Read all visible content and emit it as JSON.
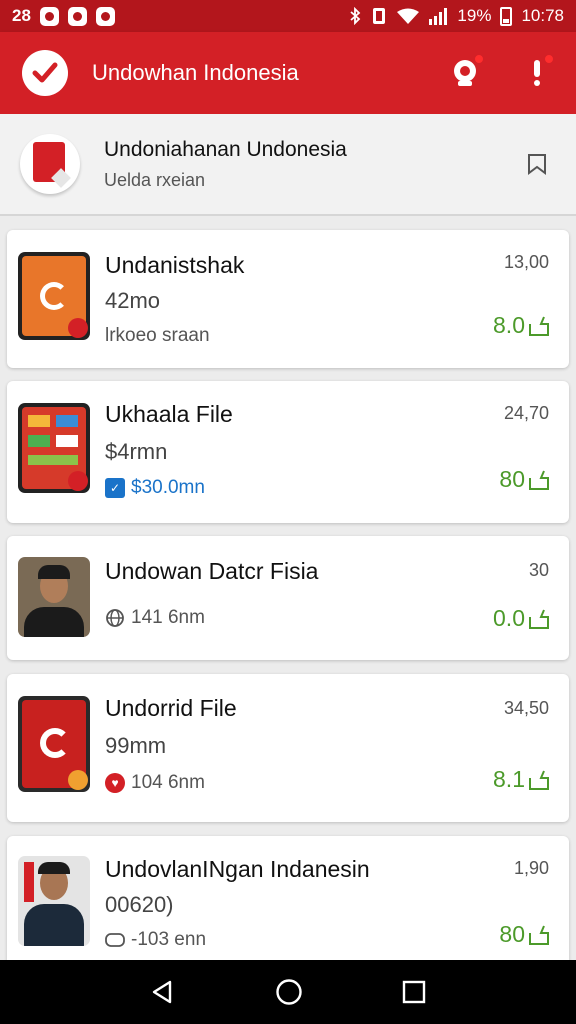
{
  "status_bar": {
    "left_text": "28",
    "right_text": "19%",
    "time": "10:78",
    "icons": [
      "notification-icon",
      "notification-icon",
      "notification-icon",
      "bluetooth-icon",
      "vibrate-icon",
      "wifi-icon",
      "signal-icon",
      "battery-icon"
    ]
  },
  "app_bar": {
    "title": "Undowhan Indonesia",
    "icons": [
      "checkmark-logo-icon",
      "camera-icon",
      "alert-icon"
    ]
  },
  "header": {
    "title": "Undoniahanan Undonesia",
    "subtitle": "Uelda rxeian",
    "icons": [
      "document-logo-icon",
      "bookmark-icon"
    ]
  },
  "items": [
    {
      "title": "Undanistshak",
      "sub": "42mo",
      "meta": "lrkoeo sraan",
      "number": "13,00",
      "score": "8.0"
    },
    {
      "title": "Ukhaala File",
      "sub": "$4rmn",
      "meta": "$30.0mn",
      "number": "24,70",
      "score": "80"
    },
    {
      "title": "Undowan Datcr Fisia",
      "sub": "",
      "meta": "141 6nm",
      "number": "30",
      "score": "0.0"
    },
    {
      "title": "Undorrid File",
      "sub": "99mm",
      "meta": "104 6nm",
      "number": "34,50",
      "score": "8.1"
    },
    {
      "title": "UndovlanINgan Indanesin",
      "sub": "00620)",
      "meta": "-103 enn",
      "number": "1,90",
      "score": "80"
    }
  ],
  "colors": {
    "brand_red": "#d32026",
    "status_red": "#b3161c",
    "score_green": "#4c9a2a",
    "link_blue": "#1a73c9"
  }
}
